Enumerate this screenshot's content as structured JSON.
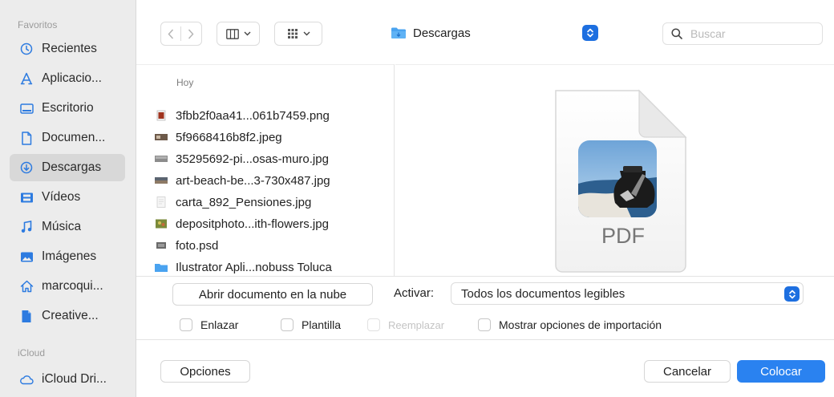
{
  "sidebar": {
    "favorites_title": "Favoritos",
    "items": [
      {
        "label": "Recientes"
      },
      {
        "label": "Aplicacio..."
      },
      {
        "label": "Escritorio"
      },
      {
        "label": "Documen..."
      },
      {
        "label": "Descargas"
      },
      {
        "label": "Vídeos"
      },
      {
        "label": "Música"
      },
      {
        "label": "Imágenes"
      },
      {
        "label": "marcoqui..."
      },
      {
        "label": "Creative..."
      }
    ],
    "icloud_title": "iCloud",
    "icloud_items": [
      {
        "label": "iCloud Dri..."
      }
    ]
  },
  "toolbar": {
    "location": "Descargas",
    "search_placeholder": "Buscar"
  },
  "list": {
    "header": "Hoy",
    "files": [
      {
        "name": "3fbb2f0aa41...061b7459.png"
      },
      {
        "name": "5f9668416b8f2.jpeg"
      },
      {
        "name": "35295692-pi...osas-muro.jpg"
      },
      {
        "name": "art-beach-be...3-730x487.jpg"
      },
      {
        "name": "carta_892_Pensiones.jpg"
      },
      {
        "name": "depositphoto...ith-flowers.jpg"
      },
      {
        "name": "foto.psd"
      },
      {
        "name": "Ilustrator Apli...nobuss Toluca"
      }
    ]
  },
  "preview": {
    "doc_type": "PDF"
  },
  "options": {
    "cloud_button": "Abrir documento en la nube",
    "activar_label": "Activar:",
    "activar_value": "Todos los documentos legibles",
    "checkboxes": {
      "enlazar": "Enlazar",
      "plantilla": "Plantilla",
      "reemplazar": "Reemplazar",
      "mostrar": "Mostrar opciones de importación"
    }
  },
  "footer": {
    "options_button": "Opciones",
    "cancel_button": "Cancelar",
    "place_button": "Colocar"
  },
  "colors": {
    "accent": "#2a82f0",
    "sidebar_icon": "#2d7be0"
  }
}
